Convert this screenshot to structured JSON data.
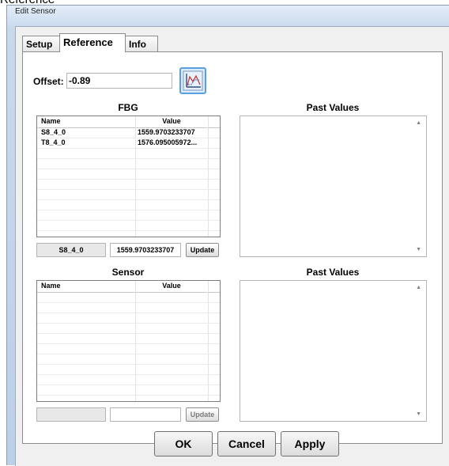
{
  "cropped_heading": "Reference",
  "window": {
    "title": "Edit Sensor"
  },
  "tabs": [
    {
      "label": "Setup",
      "active": false
    },
    {
      "label": "Reference",
      "active": true
    },
    {
      "label": "Info",
      "active": false
    }
  ],
  "offset": {
    "label": "Offset:",
    "value": "-0.89",
    "icon": "chart-icon"
  },
  "fbg": {
    "title": "FBG",
    "columns": [
      "Name",
      "Value"
    ],
    "rows": [
      {
        "name": "S8_4_0",
        "value": "1559.9703233707"
      },
      {
        "name": "T8_4_0",
        "value": "1576.095005972..."
      }
    ],
    "selected_name": "S8_4_0",
    "selected_value": "1559.9703233707",
    "update_label": "Update"
  },
  "sensor": {
    "title": "Sensor",
    "columns": [
      "Name",
      "Value"
    ],
    "rows": [],
    "selected_name": "",
    "selected_value": "",
    "update_label": "Update"
  },
  "past_values_top": {
    "title": "Past Values"
  },
  "past_values_bottom": {
    "title": "Past Values"
  },
  "buttons": {
    "ok": "OK",
    "cancel": "Cancel",
    "apply": "Apply"
  }
}
